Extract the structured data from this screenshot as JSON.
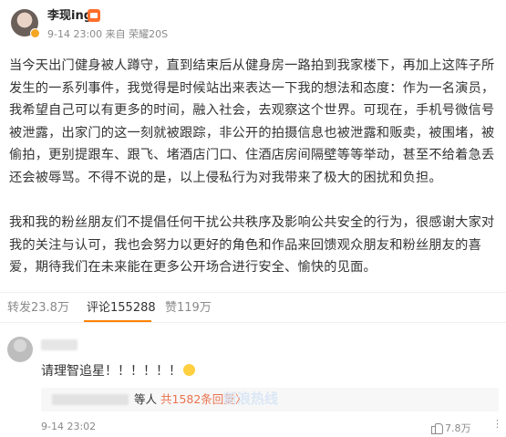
{
  "post": {
    "username": "李现ing",
    "meta": "9-14 23:00 来自 荣耀20S",
    "paragraphs": [
      "当今天出门健身被人蹲守，直到结束后从健身房一路拍到我家楼下，再加上这阵子所发生的一系列事件，我觉得是时候站出来表达一下我的想法和态度：作为一名演员，我希望自己可以有更多的时间，融入社会，去观察这个世界。可现在，手机号微信号被泄露，出家门的这一刻就被跟踪，非公开的拍摄信息也被泄露和贩卖，被围堵，被偷拍，更别提跟车、跟飞、堵酒店门口、住酒店房间隔壁等等举动，甚至不给着急丢还会被辱骂。不得不说的是，以上侵私行为对我带来了极大的困扰和负担。",
      "我和我的粉丝朋友们不提倡任何干扰公共秩序及影响公共安全的行为，很感谢大家对我的关注与认可，我也会努力以更好的角色和作品来回馈观众朋友和粉丝朋友的喜爱，期待我们在未来能在更多公开场合进行安全、愉快的见面。"
    ]
  },
  "stats": {
    "repost": "转发23.8万",
    "comment": "评论155288",
    "like": "赞119万"
  },
  "comment": {
    "text": "请理智追星！！！！！！",
    "reply_suffix": "等人",
    "reply_link": "共1582条回复",
    "reply_arrow": "〉",
    "watermark": "新浪热线",
    "time": "9-14 23:02",
    "likes": "7.8万",
    "more": "⋮"
  },
  "icons": {
    "vip": "vip-badge-icon",
    "cry": "crying-emoji-icon",
    "thumb": "thumbs-up-icon"
  },
  "colors": {
    "accent": "#ff8200",
    "link": "#eb7350",
    "muted": "#8a8a8a"
  }
}
